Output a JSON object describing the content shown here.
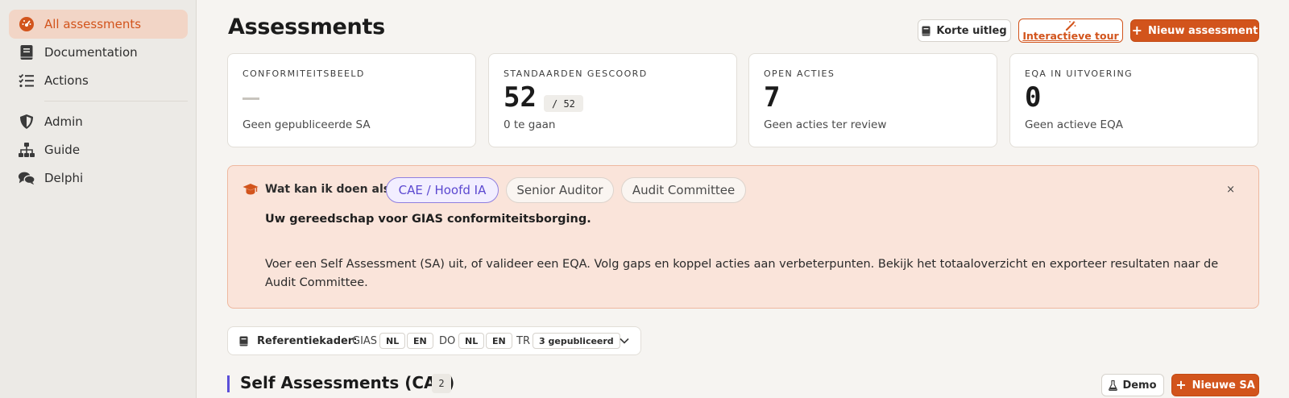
{
  "sidebar": {
    "items": [
      {
        "label": "All assessments",
        "icon": "gauge-icon",
        "active": true
      },
      {
        "label": "Documentation",
        "icon": "book-icon"
      },
      {
        "label": "Actions",
        "icon": "list-check-icon"
      },
      {
        "label": "Admin",
        "icon": "shield-icon"
      },
      {
        "label": "Guide",
        "icon": "sitemap-icon"
      },
      {
        "label": "Delphi",
        "icon": "comments-icon"
      }
    ]
  },
  "header": {
    "title": "Assessments",
    "buttons": {
      "korte_uitleg": "Korte uitleg",
      "interactieve_tour": "Interactieve tour",
      "nieuw_assessment": "Nieuw assessment"
    }
  },
  "cards": [
    {
      "label": "CONFORMITEITSBEELD",
      "value": "—",
      "sub": "Geen gepubliceerde SA"
    },
    {
      "label": "STANDAARDEN GESCOORD",
      "value": "52",
      "fraction": "/ 52",
      "sub": "0 te gaan"
    },
    {
      "label": "OPEN ACTIES",
      "value": "7",
      "sub": "Geen acties ter review"
    },
    {
      "label": "EQA IN UITVOERING",
      "value": "0",
      "sub": "Geen actieve EQA"
    }
  ],
  "info": {
    "question": "Wat kan ik doen als...",
    "roles": [
      "CAE / Hoofd IA",
      "Senior Auditor",
      "Audit Committee"
    ],
    "active_role": "CAE / Hoofd IA",
    "close": "×",
    "lead": "Uw gereedschap voor GIAS conformiteitsborging.",
    "body": "Voer een Self Assessment (SA) uit, of valideer een EQA. Volg gaps en koppel acties aan verbeterpunten. Bekijk het totaaloverzicht en exporteer resultaten naar de Audit Committee."
  },
  "reference": {
    "label": "Referentiekader:",
    "gias": "GIAS",
    "do": "DO",
    "tr": "TR",
    "nl": "NL",
    "en": "EN",
    "published": "3 gepubliceerd"
  },
  "section": {
    "title": "Self Assessments (CAE)",
    "count": "2",
    "demo": "Demo",
    "new_sa": "Nieuwe SA"
  },
  "colors": {
    "accent": "#d2541c",
    "active_nav_bg": "#f2d5c6",
    "info_bg": "#fae4da",
    "role_active": "#5b48d0"
  }
}
